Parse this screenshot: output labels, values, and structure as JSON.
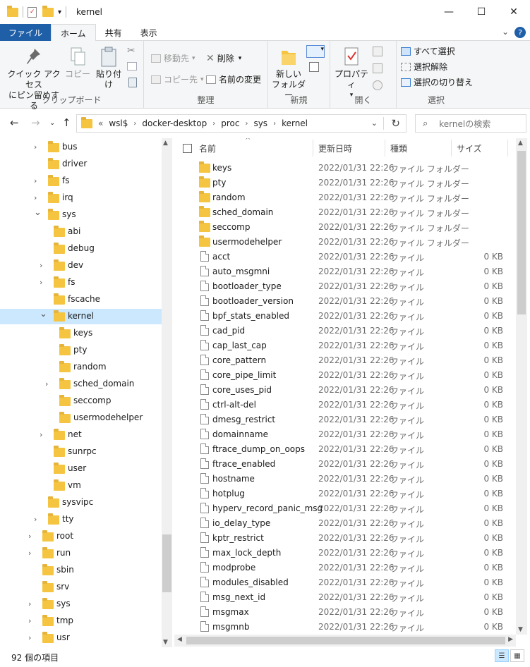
{
  "window": {
    "title": "kernel",
    "minimize": "—",
    "maximize": "☐",
    "close": "✕"
  },
  "ribbon_tabs": [
    "ファイル",
    "ホーム",
    "共有",
    "表示"
  ],
  "ribbon": {
    "clipboard": {
      "label": "クリップボード",
      "pin_line1": "クイック アクセス",
      "pin_line2": "にピン留めする",
      "copy": "コピー",
      "paste": "貼り付け"
    },
    "organize": {
      "label": "整理",
      "move_to": "移動先",
      "copy_to": "コピー先",
      "delete": "削除",
      "rename": "名前の変更"
    },
    "new": {
      "label": "新規",
      "new_folder_line1": "新しい",
      "new_folder_line2": "フォルダー"
    },
    "open": {
      "label": "開く",
      "properties": "プロパティ"
    },
    "select": {
      "label": "選択",
      "select_all": "すべて選択",
      "select_none": "選択解除",
      "invert": "選択の切り替え"
    }
  },
  "address": {
    "prefix": "«",
    "crumbs": [
      "wsl$",
      "docker-desktop",
      "proc",
      "sys",
      "kernel"
    ],
    "search_placeholder": "kernelの検索"
  },
  "tree": [
    {
      "label": "bus",
      "depth": 0,
      "expander": ">"
    },
    {
      "label": "driver",
      "depth": 0,
      "expander": ""
    },
    {
      "label": "fs",
      "depth": 0,
      "expander": ">"
    },
    {
      "label": "irq",
      "depth": 0,
      "expander": ">"
    },
    {
      "label": "sys",
      "depth": 0,
      "expander": "v"
    },
    {
      "label": "abi",
      "depth": 1,
      "expander": ""
    },
    {
      "label": "debug",
      "depth": 1,
      "expander": ""
    },
    {
      "label": "dev",
      "depth": 1,
      "expander": ">"
    },
    {
      "label": "fs",
      "depth": 1,
      "expander": ">"
    },
    {
      "label": "fscache",
      "depth": 1,
      "expander": ""
    },
    {
      "label": "kernel",
      "depth": 1,
      "expander": "v",
      "selected": true
    },
    {
      "label": "keys",
      "depth": 2,
      "expander": ""
    },
    {
      "label": "pty",
      "depth": 2,
      "expander": ""
    },
    {
      "label": "random",
      "depth": 2,
      "expander": ""
    },
    {
      "label": "sched_domain",
      "depth": 2,
      "expander": ">"
    },
    {
      "label": "seccomp",
      "depth": 2,
      "expander": ""
    },
    {
      "label": "usermodehelper",
      "depth": 2,
      "expander": ""
    },
    {
      "label": "net",
      "depth": 1,
      "expander": ">"
    },
    {
      "label": "sunrpc",
      "depth": 1,
      "expander": ""
    },
    {
      "label": "user",
      "depth": 1,
      "expander": ""
    },
    {
      "label": "vm",
      "depth": 1,
      "expander": ""
    },
    {
      "label": "sysvipc",
      "depth": 0,
      "expander": ""
    },
    {
      "label": "tty",
      "depth": 0,
      "expander": ">"
    },
    {
      "label": "root",
      "depth": -1,
      "expander": ">"
    },
    {
      "label": "run",
      "depth": -1,
      "expander": ">"
    },
    {
      "label": "sbin",
      "depth": -1,
      "expander": ""
    },
    {
      "label": "srv",
      "depth": -1,
      "expander": ""
    },
    {
      "label": "sys",
      "depth": -1,
      "expander": ">"
    },
    {
      "label": "tmp",
      "depth": -1,
      "expander": ">"
    },
    {
      "label": "usr",
      "depth": -1,
      "expander": ">"
    }
  ],
  "columns": {
    "name": "名前",
    "date": "更新日時",
    "type": "種類",
    "size": "サイズ"
  },
  "date_value": "2022/01/31 22:26",
  "folder_type": "ファイル フォルダー",
  "file_type": "ファイル",
  "file_size": "0 KB",
  "folders": [
    "keys",
    "pty",
    "random",
    "sched_domain",
    "seccomp",
    "usermodehelper"
  ],
  "files": [
    "acct",
    "auto_msgmni",
    "bootloader_type",
    "bootloader_version",
    "bpf_stats_enabled",
    "cad_pid",
    "cap_last_cap",
    "core_pattern",
    "core_pipe_limit",
    "core_uses_pid",
    "ctrl-alt-del",
    "dmesg_restrict",
    "domainname",
    "ftrace_dump_on_oops",
    "ftrace_enabled",
    "hostname",
    "hotplug",
    "hyperv_record_panic_msg",
    "io_delay_type",
    "kptr_restrict",
    "max_lock_depth",
    "modprobe",
    "modules_disabled",
    "msg_next_id",
    "msgmax",
    "msgmnb"
  ],
  "status": {
    "count": "92 個の項目"
  }
}
